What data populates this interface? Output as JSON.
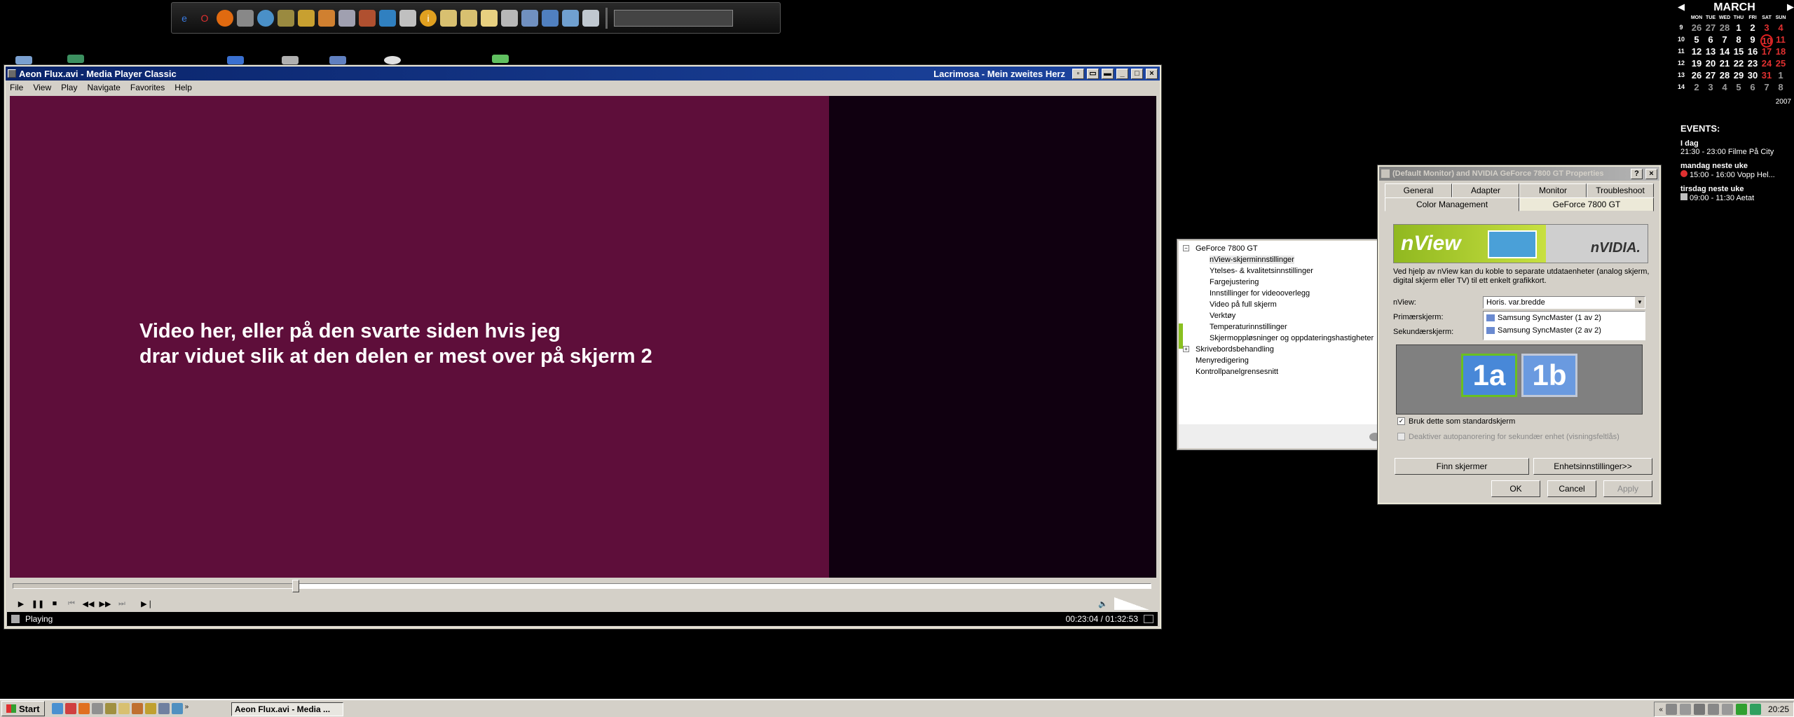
{
  "desktop": {
    "quicklaunch_icons": [
      "ie-icon",
      "opera-icon",
      "firefox-icon",
      "tool-icon",
      "globe-icon",
      "media-icon",
      "edit-icon",
      "paint-icon",
      "network-icon",
      "calc-icon",
      "book-icon",
      "scissors-icon",
      "info-icon",
      "folder-icon",
      "folder-icon",
      "docs-icon",
      "drive-icon",
      "computer-icon",
      "network-icon",
      "recycle-icon",
      "trash-icon"
    ]
  },
  "mpc": {
    "title": "Aeon Flux.avi - Media Player Classic",
    "title_right": "Lacrimosa - Mein zweites Herz",
    "menu": [
      "File",
      "View",
      "Play",
      "Navigate",
      "Favorites",
      "Help"
    ],
    "video_caption": "Video her, eller på den svarte siden hvis jeg\ndrar viduet slik at den delen er mest over på skjerm 2",
    "status": "Playing",
    "time": "00:23:04 / 01:32:53",
    "seek_fraction": 0.248
  },
  "nvtree": {
    "root": "GeForce 7800 GT",
    "items": [
      "nView-skjerminnstillinger",
      "Ytelses- & kvalitetsinnstillinger",
      "Fargejustering",
      "Innstillinger for videooverlegg",
      "Video på full skjerm",
      "Verktøy",
      "Temperaturinnstillinger",
      "Skjermoppløsninger og oppdateringshastigheter"
    ],
    "root_items": [
      "Skrivebordsbehandling",
      "Menyredigering",
      "Kontrollpanelgrensesnitt"
    ]
  },
  "props": {
    "title": "(Default Monitor) and NVIDIA GeForce 7800 GT Properties",
    "tabs_row1": [
      "General",
      "Adapter",
      "Monitor",
      "Troubleshoot"
    ],
    "tabs_row2": [
      "Color Management",
      "GeForce 7800 GT"
    ],
    "nview_logo": "nView",
    "nvidia_logo": "nVIDIA.",
    "description": "Ved hjelp av nView kan du koble to separate utdataenheter (analog skjerm, digital skjerm eller TV) til ett enkelt grafikkort.",
    "nview_label": "nView:",
    "nview_value": "Horis. var.bredde",
    "primary_label": "Primærskjerm:",
    "primary_value": "Samsung SyncMaster (1 av 2)",
    "secondary_label": "Sekundærskjerm:",
    "secondary_value": "Samsung SyncMaster (2 av 2)",
    "monitor_a": "1a",
    "monitor_b": "1b",
    "checkbox1": "Bruk dette som standardskjerm",
    "checkbox2": "Deaktiver autopanorering for sekundær enhet (visningsfeltlås)",
    "find_button": "Finn skjermer",
    "settings_button": "Enhetsinnstillinger>>",
    "ok": "OK",
    "cancel": "Cancel",
    "apply": "Apply"
  },
  "calendar": {
    "month": "MARCH",
    "year": "2007",
    "dow": [
      "MON",
      "TUE",
      "WED",
      "THU",
      "FRI",
      "SAT",
      "SUN"
    ],
    "weeks": [
      {
        "wk": "9",
        "days": [
          "26",
          "27",
          "28",
          "1",
          "2",
          "3",
          "4"
        ]
      },
      {
        "wk": "10",
        "days": [
          "5",
          "6",
          "7",
          "8",
          "9",
          "10",
          "11"
        ]
      },
      {
        "wk": "11",
        "days": [
          "12",
          "13",
          "14",
          "15",
          "16",
          "17",
          "18"
        ]
      },
      {
        "wk": "12",
        "days": [
          "19",
          "20",
          "21",
          "22",
          "23",
          "24",
          "25"
        ]
      },
      {
        "wk": "13",
        "days": [
          "26",
          "27",
          "28",
          "29",
          "30",
          "31",
          "1"
        ]
      },
      {
        "wk": "14",
        "days": [
          "2",
          "3",
          "4",
          "5",
          "6",
          "7",
          "8"
        ]
      }
    ],
    "today": "10"
  },
  "events": {
    "heading": "EVENTS:",
    "items": [
      {
        "day": "I dag",
        "detail": "21:30 - 23:00 Filme På City"
      },
      {
        "day": "mandag neste uke",
        "detail": "15:00 - 16:00 Vopp Hel..."
      },
      {
        "day": "tirsdag neste uke",
        "detail": "09:00 - 11:30 Aetat"
      }
    ]
  },
  "taskbar": {
    "start": "Start",
    "task": "Aeon Flux.avi - Media ...",
    "clock": "20:25"
  }
}
